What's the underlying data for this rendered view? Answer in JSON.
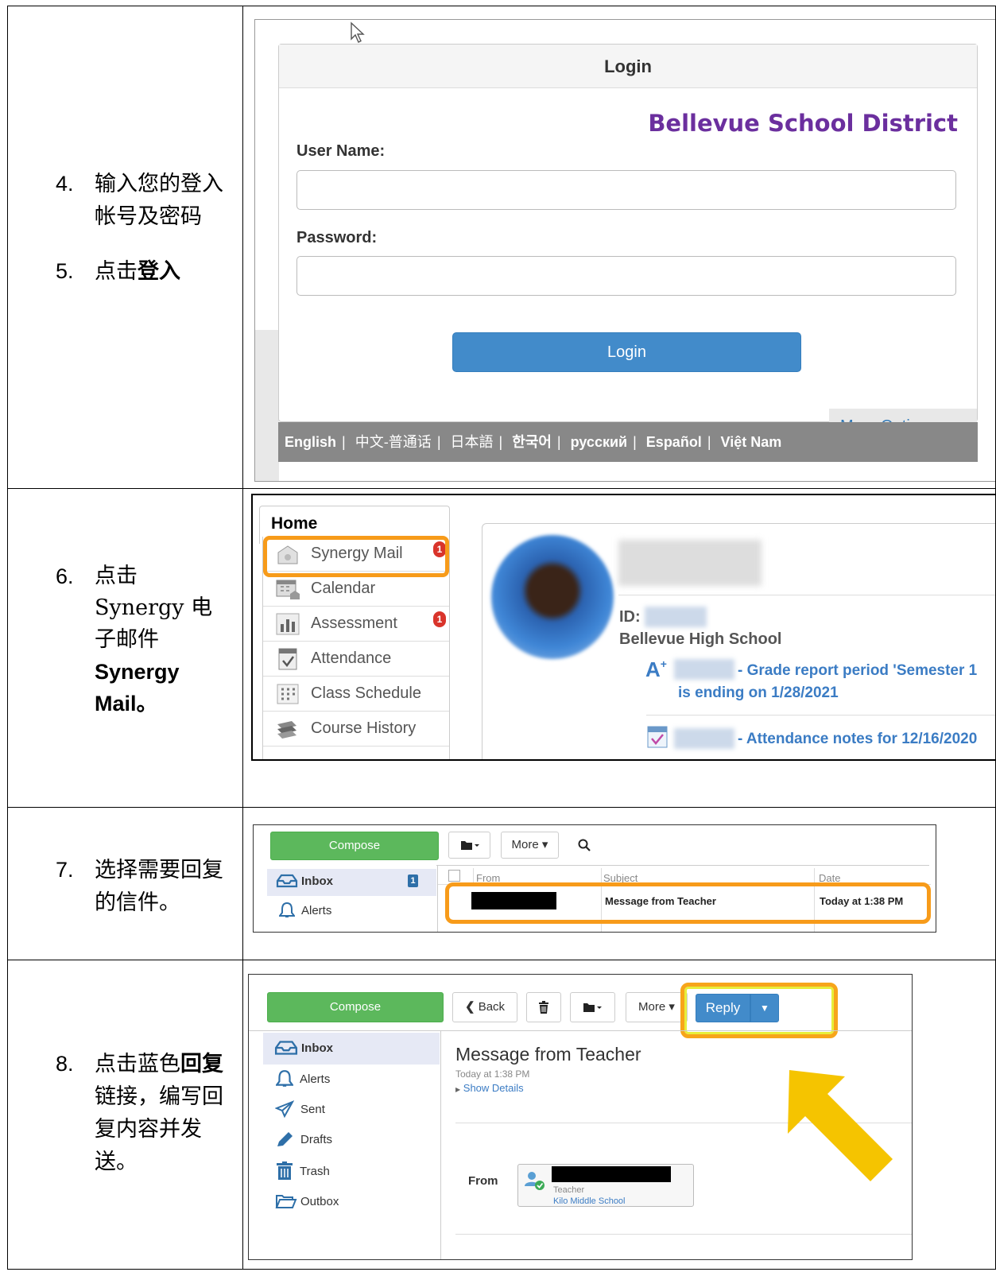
{
  "steps": {
    "s4_num": "4.",
    "s4_text": "输入您的登入帐号及密码",
    "s5_num": "5.",
    "s5_prefix": "点击",
    "s5_bold": "登入",
    "s6_num": "6.",
    "s6_prefix": "点击",
    "s6_mid": "Synergy 电子邮件",
    "s6_bold": "Synergy Mail。",
    "s7_num": "7.",
    "s7_text": "选择需要回复的信件。",
    "s8_num": "8.",
    "s8_prefix": "点击蓝色",
    "s8_bold": "回复",
    "s8_suffix": "链接，编写回复内容并发送。"
  },
  "login": {
    "header": "Login",
    "district": "Bellevue School District",
    "username_label": "User Name:",
    "password_label": "Password:",
    "login_button": "Login",
    "more_options": "More Options",
    "languages": [
      "English",
      "中文-普通话",
      "日本語",
      "한국어",
      "русский",
      "Español",
      "Việt Nam"
    ]
  },
  "home": {
    "tab": "Home",
    "nav": [
      {
        "label": "Synergy Mail",
        "badge": "1",
        "icon": "mail-icon"
      },
      {
        "label": "Calendar",
        "badge": "",
        "icon": "calendar-icon"
      },
      {
        "label": "Assessment",
        "badge": "1",
        "icon": "chart-icon"
      },
      {
        "label": "Attendance",
        "badge": "",
        "icon": "attendance-icon"
      },
      {
        "label": "Class Schedule",
        "badge": "",
        "icon": "schedule-icon"
      },
      {
        "label": "Course History",
        "badge": "",
        "icon": "books-icon"
      }
    ],
    "id_label": "ID:",
    "school": "Bellevue High School",
    "notice1_line1": "- Grade report period 'Semester 1",
    "notice1_line2": "is ending on 1/28/2021",
    "notice2": "- Attendance notes for 12/16/2020"
  },
  "mail_list": {
    "compose": "Compose",
    "more": "More",
    "inbox": "Inbox",
    "inbox_count": "1",
    "alerts": "Alerts",
    "col_from": "From",
    "col_subject": "Subject",
    "col_date": "Date",
    "row_subject": "Message from Teacher",
    "row_date": "Today at 1:38 PM"
  },
  "message": {
    "compose": "Compose",
    "back": "Back",
    "more": "More",
    "reply": "Reply",
    "folders": [
      "Inbox",
      "Alerts",
      "Sent",
      "Drafts",
      "Trash",
      "Outbox"
    ],
    "title": "Message from Teacher",
    "time": "Today at 1:38 PM",
    "show_details": "Show Details",
    "from_label": "From",
    "sender_role": "Teacher",
    "sender_school": "Kilo Middle School"
  },
  "colors": {
    "highlight": "#f79b1a",
    "arrow": "#f5c400",
    "district": "#6b2f9e",
    "primary": "#428bca",
    "compose": "#5cb85c"
  }
}
